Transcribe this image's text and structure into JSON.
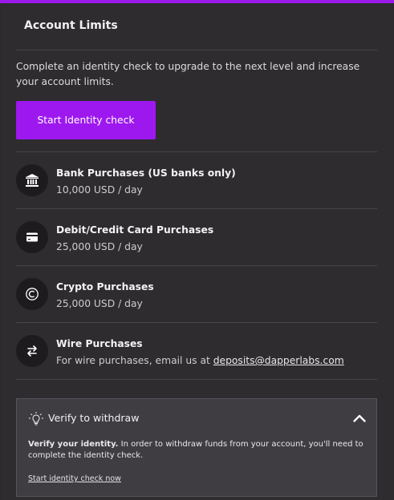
{
  "header": {
    "title": "Account Limits"
  },
  "intro": {
    "text": "Complete an identity check to upgrade to the next level and increase your account limits."
  },
  "cta": {
    "label": "Start Identity check",
    "color": "#9d18ee"
  },
  "limits": [
    {
      "name": "Bank Purchases (US banks only)",
      "value": "10,000 USD / day",
      "icon": "bank-icon"
    },
    {
      "name": "Debit/Credit Card Purchases",
      "value": "25,000 USD / day",
      "icon": "credit-card-icon"
    },
    {
      "name": "Crypto Purchases",
      "value": "25,000 USD / day",
      "icon": "crypto-coin-icon"
    },
    {
      "name": "Wire Purchases",
      "value_prefix": "For wire purchases, email us at ",
      "email": "deposits@dapperlabs.com",
      "icon": "transfer-arrows-icon"
    }
  ],
  "notice": {
    "title": "Verify to withdraw",
    "bold": "Verify your identity.",
    "text": " In order to withdraw funds from your account, you'll need to complete the identity check.",
    "link": "Start identity check now",
    "icon": "lightbulb-icon",
    "toggle_icon": "chevron-up-icon"
  }
}
